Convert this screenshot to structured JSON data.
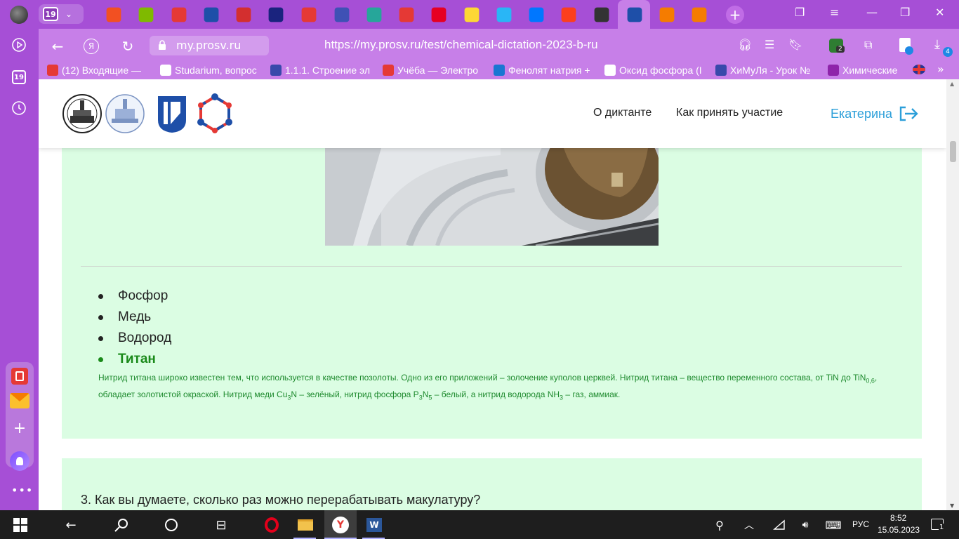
{
  "tabs": {
    "counter": "19",
    "items": [
      {
        "name": "tab-microsoft",
        "color": "#f25022"
      },
      {
        "name": "tab-microsoft-2",
        "color": "#7fba00"
      },
      {
        "name": "tab-red-book",
        "color": "#e53935"
      },
      {
        "name": "tab-prosv",
        "color": "#1e4fa8"
      },
      {
        "name": "tab-flag",
        "color": "#d32f2f"
      },
      {
        "name": "tab-swoosh",
        "color": "#1a237e"
      },
      {
        "name": "tab-n",
        "color": "#e53935"
      },
      {
        "name": "tab-globe",
        "color": "#3f51b5"
      },
      {
        "name": "tab-book",
        "color": "#26a69a"
      },
      {
        "name": "tab-play",
        "color": "#e53935"
      },
      {
        "name": "tab-pinterest",
        "color": "#e60023"
      },
      {
        "name": "tab-drill",
        "color": "#fdd835"
      },
      {
        "name": "tab-spiral",
        "color": "#29b6f6"
      },
      {
        "name": "tab-vk",
        "color": "#0077ff"
      },
      {
        "name": "tab-yandex",
        "color": "#fc3f1d"
      },
      {
        "name": "tab-li",
        "color": "#333333"
      },
      {
        "name": "tab-prosv-active",
        "color": "#1e4fa8"
      },
      {
        "name": "tab-paper-1",
        "color": "#f57c00"
      },
      {
        "name": "tab-paper-2",
        "color": "#f57c00"
      }
    ]
  },
  "addressbar": {
    "domain": "my.prosv.ru",
    "url": "https://my.prosv.ru/test/chemical-dictation-2023-b-ru",
    "extension_badge": "2",
    "downloads_badge": "4"
  },
  "bookmarks": [
    {
      "label": "(12) Входящие — ",
      "color": "#e53935"
    },
    {
      "label": "Studarium, вопрос",
      "color": "#ffffff"
    },
    {
      "label": "1.1.1. Строение эл",
      "color": "#3949ab"
    },
    {
      "label": "Учёба — Электро",
      "color": "#e53935"
    },
    {
      "label": "Фенолят натрия +",
      "color": "#1976d2"
    },
    {
      "label": "Оксид фосфора (I",
      "color": "#ffffff"
    },
    {
      "label": "ХиМуЛя - Урок №",
      "color": "#3949ab"
    },
    {
      "label": "Химические",
      "color": "#8e24aa"
    }
  ],
  "sidebar": {
    "counter": "19"
  },
  "site": {
    "nav": {
      "about": "О диктанте",
      "how": "Как принять участие"
    },
    "user": "Екатерина"
  },
  "question1": {
    "options": [
      "Фосфор",
      "Медь",
      "Водород",
      "Титан"
    ],
    "correct_index": 3,
    "explanation": {
      "p1": "Нитрид титана широко известен тем, что используется в качестве позолоты. Одно из его приложений – золочение куполов церквей. Нитрид титана – вещество переменного состава, от TiN до TiN",
      "s1": "0,6",
      "p2": ", обладает золотистой окраской. Нитрид меди Cu",
      "s2": "3",
      "p3": "N – зелёный, нитрид фосфора P",
      "s3": "3",
      "p4": "N",
      "s4": "5",
      "p5": " – белый, а нитрид водорода NH",
      "s5": "3",
      "p6": " – газ, аммиак."
    }
  },
  "question2": {
    "text": "3. Как вы думаете, сколько раз можно перерабатывать макулатуру?"
  },
  "taskbar": {
    "lang": "РУС",
    "time": "8:52",
    "date": "15.05.2023",
    "notifications": "1"
  }
}
